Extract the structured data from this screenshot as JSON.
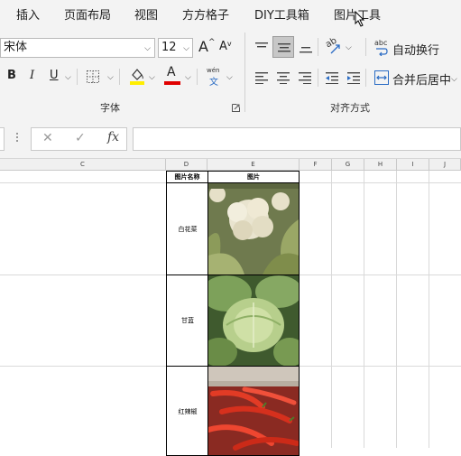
{
  "tabs": [
    "插入",
    "页面布局",
    "视图",
    "方方格子",
    "DIY工具箱",
    "图片工具"
  ],
  "font": {
    "name": "宋体",
    "size": "12",
    "group_label": "字体",
    "grow_glyph": "A",
    "shrink_glyph": "A",
    "bold": "B",
    "italic": "I",
    "underline": "U",
    "font_color_glyph": "A",
    "pinyin_top": "wén",
    "pinyin_bottom": "文"
  },
  "alignment": {
    "group_label": "对齐方式",
    "wrap_text": "自动换行",
    "merge_center": "合并后居中",
    "orient_glyph": "ab",
    "wrap_glyph": "abc"
  },
  "formula_bar": {
    "cancel": "✕",
    "enter": "✓",
    "fx": "fx",
    "value": ""
  },
  "columns": [
    "C",
    "D",
    "E",
    "F",
    "G",
    "H",
    "I",
    "J"
  ],
  "table": {
    "header_name": "图片名称",
    "header_pic": "图片",
    "rows": [
      {
        "name": "白花菜"
      },
      {
        "name": "甘蓝"
      },
      {
        "name": "红辣椒"
      }
    ]
  },
  "colors": {
    "highlight": "#ffee00",
    "font_color": "#e00000",
    "accent_blue": "#2b6cc4"
  }
}
